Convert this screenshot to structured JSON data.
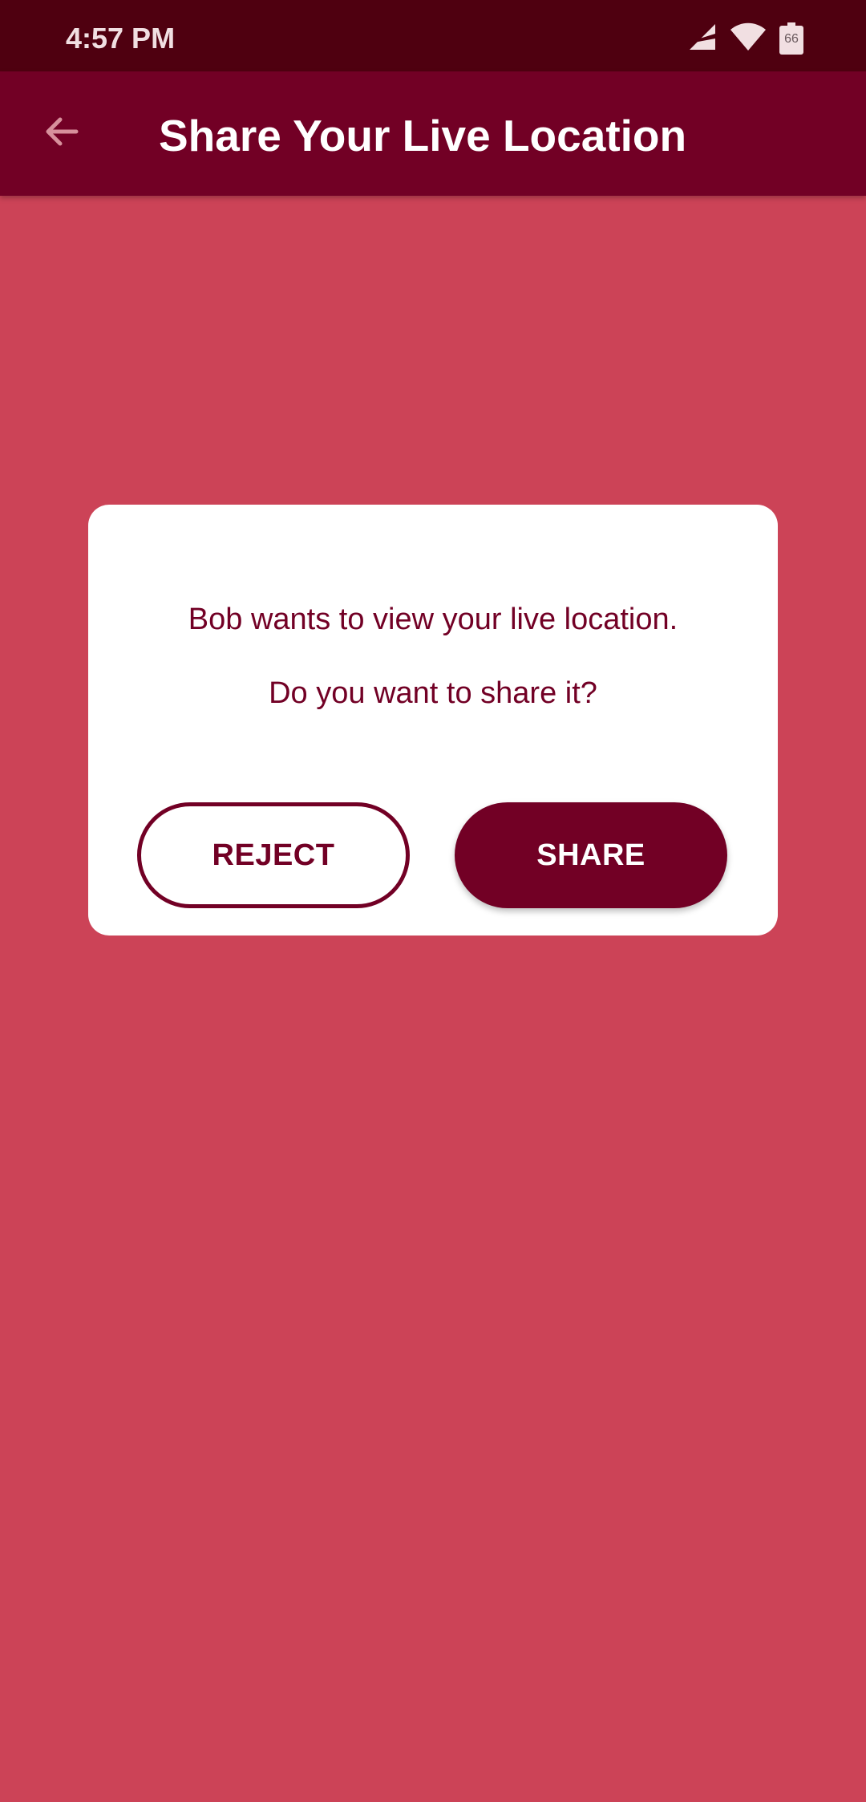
{
  "status_bar": {
    "time": "4:57 PM",
    "battery_level": "66",
    "icons": [
      "signal-icon",
      "wifi-icon",
      "battery-icon"
    ]
  },
  "app_bar": {
    "title": "Share Your Live Location",
    "back_icon": "arrow-back-icon"
  },
  "dialog": {
    "message": "Bob wants to view your live location.",
    "question": "Do you want to share it?",
    "reject_label": "REJECT",
    "share_label": "SHARE"
  },
  "colors": {
    "status_bar_bg": "#4f0010",
    "app_bar_bg": "#720025",
    "page_bg": "#cc4357",
    "dialog_bg": "#ffffff",
    "accent": "#720025"
  }
}
